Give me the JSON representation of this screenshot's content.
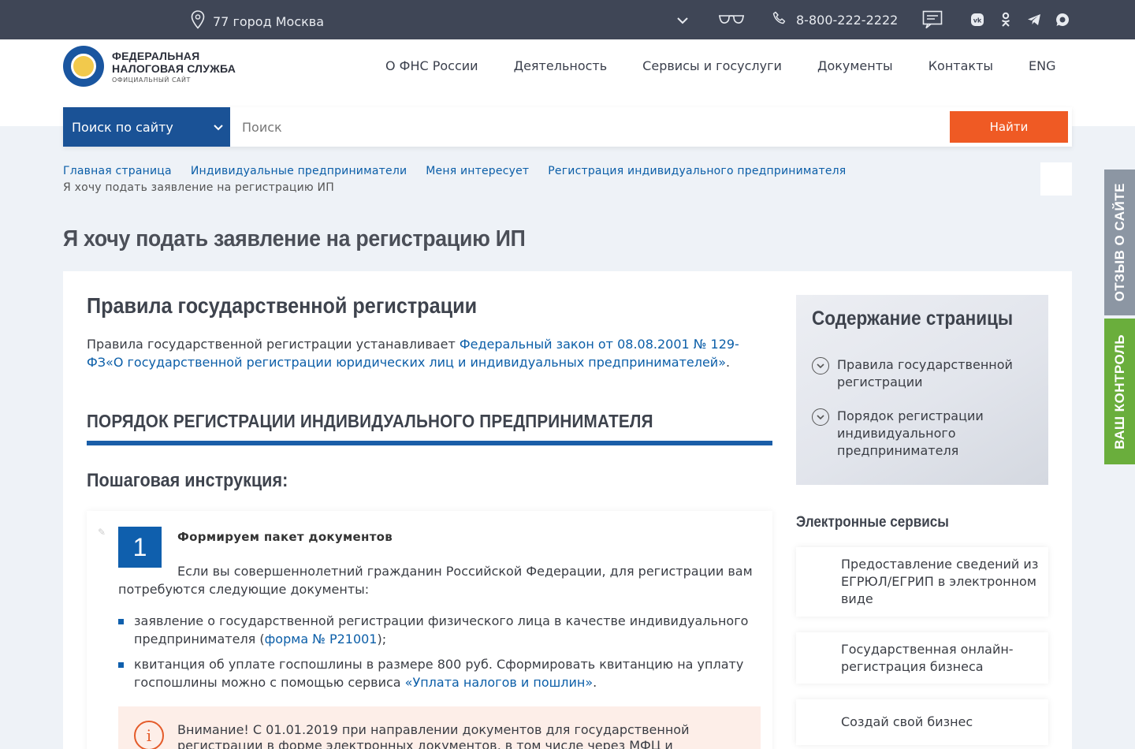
{
  "topbar": {
    "location": "77 город Москва",
    "phone": "8-800-222-2222",
    "icons": {
      "location": "map-pin-icon",
      "dropdown": "chevron-down-icon",
      "accessibility": "glasses-icon",
      "phone": "phone-icon",
      "feedback": "message-icon",
      "socials": [
        "vk-icon",
        "odnoklassniki-icon",
        "telegram-icon",
        "max-icon"
      ]
    }
  },
  "logo": {
    "line1": "ФЕДЕРАЛЬНАЯ",
    "line2": "НАЛОГОВАЯ СЛУЖБА",
    "line3": "ОФИЦИАЛЬНЫЙ САЙТ"
  },
  "nav": {
    "items": [
      "О ФНС России",
      "Деятельность",
      "Сервисы и госуслуги",
      "Документы",
      "Контакты",
      "ENG"
    ]
  },
  "search": {
    "scope": "Поиск по сайту",
    "placeholder": "Поиск",
    "button": "Найти"
  },
  "breadcrumb": {
    "links": [
      "Главная страница",
      "Индивидуальные предприниматели",
      "Меня интересует",
      "Регистрация индивидуального предпринимателя"
    ],
    "current": "Я хочу подать заявление на регистрацию ИП"
  },
  "page_title": "Я хочу подать заявление на регистрацию ИП",
  "main": {
    "section_title": "Правила государственной регистрации",
    "intro_text": "Правила государственной регистрации устанавливает ",
    "intro_link": "Федеральный закон от 08.08.2001 № 129-ФЗ«О государственной регистрации юридических лиц и индивидуальных предпринимателей»",
    "intro_end": ".",
    "procedure_title": "ПОРЯДОК РЕГИСТРАЦИИ ИНДИВИДУАЛЬНОГО ПРЕДПРИНИМАТЕЛЯ",
    "instruction_title": "Пошаговая инструкция:",
    "step": {
      "number": "1",
      "title": "Формируем пакет документов",
      "description": "Если вы совершеннолетний гражданин Российской Федерации, для регистрации вам потребуются следующие документы:",
      "items": [
        {
          "text": "заявление о государственной регистрации физического лица в качестве индивидуального предпринимателя (",
          "link": "форма № Р21001",
          "end": ");"
        },
        {
          "text": "квитанция об уплате госпошлины в размере 800 руб. Сформировать квитанцию на уплату госпошлины можно с помощью сервиса ",
          "link": "«Уплата налогов и пошлин»",
          "end": "."
        }
      ],
      "warning": "Внимание! С 01.01.2019 при направлении документов для государственной регистрации в форме электронных документов, в том числе через МФЦ и"
    }
  },
  "toc": {
    "title": "Содержание страницы",
    "items": [
      "Правила государственной регистрации",
      "Порядок регистрации индивидуального предпринимателя"
    ]
  },
  "services": {
    "title": "Электронные сервисы",
    "items": [
      "Предоставление сведений из ЕГРЮЛ/ЕГРИП в электронном виде",
      "Государственная онлайн-регистрация бизнеса",
      "Создай свой бизнес"
    ]
  },
  "side_tabs": {
    "feedback": "ОТЗЫВ О САЙТЕ",
    "control": "ВАШ КОНТРОЛЬ"
  },
  "colors": {
    "topbar": "#3f4656",
    "brand_blue": "#1a5296",
    "accent_orange": "#ef5a24",
    "link": "#0b5ea8",
    "tab_gray": "#8c96a3",
    "tab_green": "#6aae3c"
  }
}
